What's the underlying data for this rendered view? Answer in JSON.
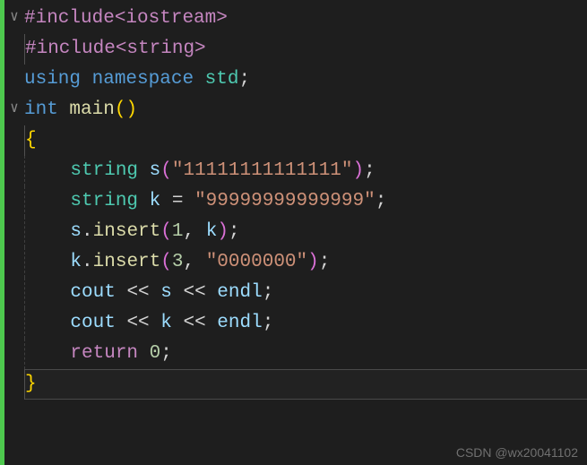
{
  "code": {
    "l1": {
      "directive": "#include",
      "path": "<iostream>"
    },
    "l2": {
      "directive": "#include",
      "path": "<string>"
    },
    "l3": {
      "kw1": "using",
      "kw2": "namespace",
      "ns": "std",
      "semi": ";"
    },
    "l4": {
      "type": "int",
      "func": "main",
      "p1": "(",
      "p2": ")"
    },
    "l5": {
      "brace": "{"
    },
    "l6": {
      "type": "string",
      "var": "s",
      "p1": "(",
      "str": "\"11111111111111\"",
      "p2": ")",
      "semi": ";"
    },
    "l7": {
      "type": "string",
      "var": "k",
      "eq": " = ",
      "str": "\"99999999999999\"",
      "semi": ";"
    },
    "l8": {
      "obj": "s",
      "dot": ".",
      "method": "insert",
      "p1": "(",
      "n": "1",
      "comma": ", ",
      "arg": "k",
      "p2": ")",
      "semi": ";"
    },
    "l9": {
      "obj": "k",
      "dot": ".",
      "method": "insert",
      "p1": "(",
      "n": "3",
      "comma": ", ",
      "str": "\"0000000\"",
      "p2": ")",
      "semi": ";"
    },
    "l10": {
      "obj": "cout",
      "op1": " << ",
      "v1": "s",
      "op2": " << ",
      "v2": "endl",
      "semi": ";"
    },
    "l11": {
      "obj": "cout",
      "op1": " << ",
      "v1": "k",
      "op2": " << ",
      "v2": "endl",
      "semi": ";"
    },
    "l12": {
      "kw": "return",
      "n": "0",
      "semi": ";"
    },
    "l13": {
      "brace": "}"
    }
  },
  "watermark": "CSDN @wx20041102"
}
